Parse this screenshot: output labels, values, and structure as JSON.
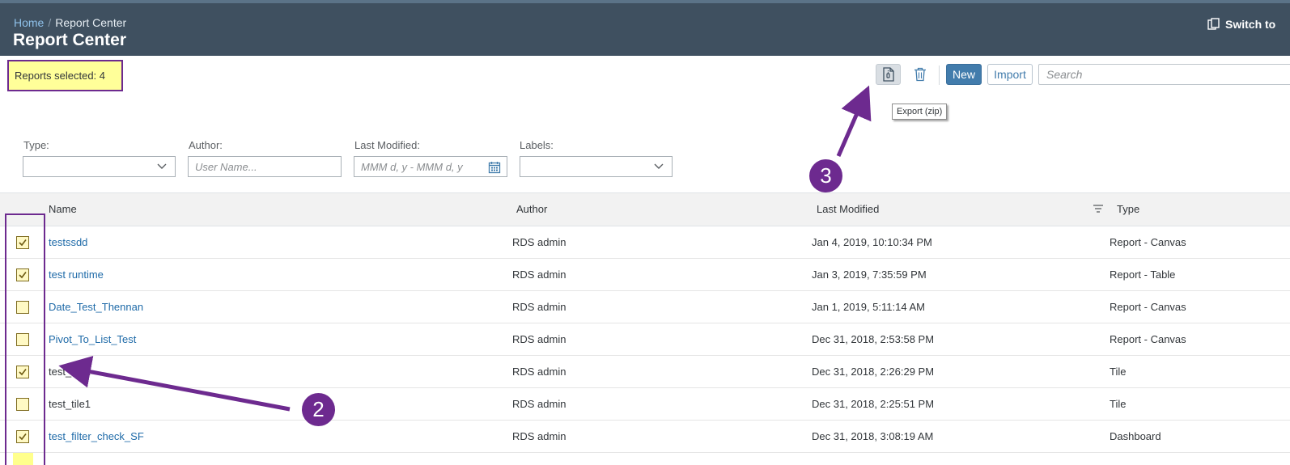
{
  "header": {
    "breadcrumb_home": "Home",
    "breadcrumb_separator": "/",
    "breadcrumb_current": "Report Center",
    "title": "Report Center",
    "switch_label": "Switch to"
  },
  "selection": {
    "label": "Reports selected: 4"
  },
  "toolbar": {
    "new_label": "New",
    "import_label": "Import",
    "search_placeholder": "Search",
    "export_tooltip": "Export (zip)"
  },
  "filters": {
    "type_label": "Type:",
    "author_label": "Author:",
    "author_placeholder": "User Name...",
    "modified_label": "Last Modified:",
    "modified_placeholder": "MMM d, y - MMM d, y",
    "labels_label": "Labels:"
  },
  "table": {
    "columns": {
      "name": "Name",
      "author": "Author",
      "modified": "Last Modified",
      "type": "Type"
    },
    "rows": [
      {
        "name": "testssdd",
        "author": "RDS admin",
        "modified": "Jan 4, 2019, 10:10:34 PM",
        "type": "Report - Canvas",
        "checked": true
      },
      {
        "name": "test runtime",
        "author": "RDS admin",
        "modified": "Jan 3, 2019, 7:35:59 PM",
        "type": "Report - Table",
        "checked": true
      },
      {
        "name": "Date_Test_Thennan",
        "author": "RDS admin",
        "modified": "Jan 1, 2019, 5:11:14 AM",
        "type": "Report - Canvas",
        "checked": false
      },
      {
        "name": "Pivot_To_List_Test",
        "author": "RDS admin",
        "modified": "Dec 31, 2018, 2:53:58 PM",
        "type": "Report - Canvas",
        "checked": false
      },
      {
        "name": "test_tile2",
        "author": "RDS admin",
        "modified": "Dec 31, 2018, 2:26:29 PM",
        "type": "Tile",
        "checked": true
      },
      {
        "name": "test_tile1",
        "author": "RDS admin",
        "modified": "Dec 31, 2018, 2:25:51 PM",
        "type": "Tile",
        "checked": false
      },
      {
        "name": "test_filter_check_SF",
        "author": "RDS admin",
        "modified": "Dec 31, 2018, 3:08:19 AM",
        "type": "Dashboard",
        "checked": true
      }
    ]
  },
  "annotations": {
    "step2": "2",
    "step3": "3"
  },
  "colors": {
    "header": "#3f5060",
    "accent": "#427cac",
    "annotation": "#6d2a8f",
    "highlight": "#ffff99",
    "link": "#1e6aa8"
  },
  "icons": [
    "export-zip-icon",
    "trash-icon",
    "search-icon",
    "chevron-down-icon",
    "calendar-icon",
    "sort-icon",
    "checkbox-checked-icon",
    "switch-icon"
  ]
}
